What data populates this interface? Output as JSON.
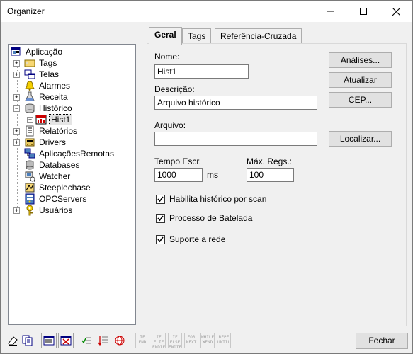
{
  "window": {
    "title": "Organizer"
  },
  "tree": {
    "items": [
      {
        "label": "Aplicação"
      },
      {
        "label": "Tags"
      },
      {
        "label": "Telas"
      },
      {
        "label": "Alarmes"
      },
      {
        "label": "Receita"
      },
      {
        "label": "Histórico"
      },
      {
        "label": "Hist1"
      },
      {
        "label": "Relatórios"
      },
      {
        "label": "Drivers"
      },
      {
        "label": "AplicaçõesRemotas"
      },
      {
        "label": "Databases"
      },
      {
        "label": "Watcher"
      },
      {
        "label": "Steeplechase"
      },
      {
        "label": "OPCServers"
      },
      {
        "label": "Usuários"
      }
    ]
  },
  "tabs": [
    {
      "label": "Geral"
    },
    {
      "label": "Tags"
    },
    {
      "label": "Referência-Cruzada"
    }
  ],
  "form": {
    "nome_label": "Nome:",
    "nome_value": "Hist1",
    "descricao_label": "Descrição:",
    "descricao_value": "Arquivo histórico",
    "arquivo_label": "Arquivo:",
    "arquivo_value": "",
    "tempo_label": "Tempo Escr.",
    "tempo_value": "1000",
    "tempo_unit": "ms",
    "maxregs_label": "Máx. Regs.:",
    "maxregs_value": "100",
    "checkboxes": [
      {
        "label": "Habilita histórico por scan",
        "checked": true
      },
      {
        "label": "Processo de Batelada",
        "checked": true
      },
      {
        "label": "Suporte a rede",
        "checked": true
      }
    ]
  },
  "buttons": {
    "analises": "Análises...",
    "atualizar": "Atualizar",
    "cep": "CEP...",
    "localizar": "Localizar...",
    "fechar": "Fechar"
  },
  "toolbar": {
    "keywords": [
      [
        "IF",
        "END"
      ],
      [
        "IF",
        "ELIF",
        "ENDIF"
      ],
      [
        "IF",
        "ELSE",
        "ENDIF"
      ],
      [
        "FOR",
        "NEXT"
      ],
      [
        "WHILE",
        "WEND"
      ],
      [
        "REPE",
        "UNTIL"
      ]
    ]
  }
}
